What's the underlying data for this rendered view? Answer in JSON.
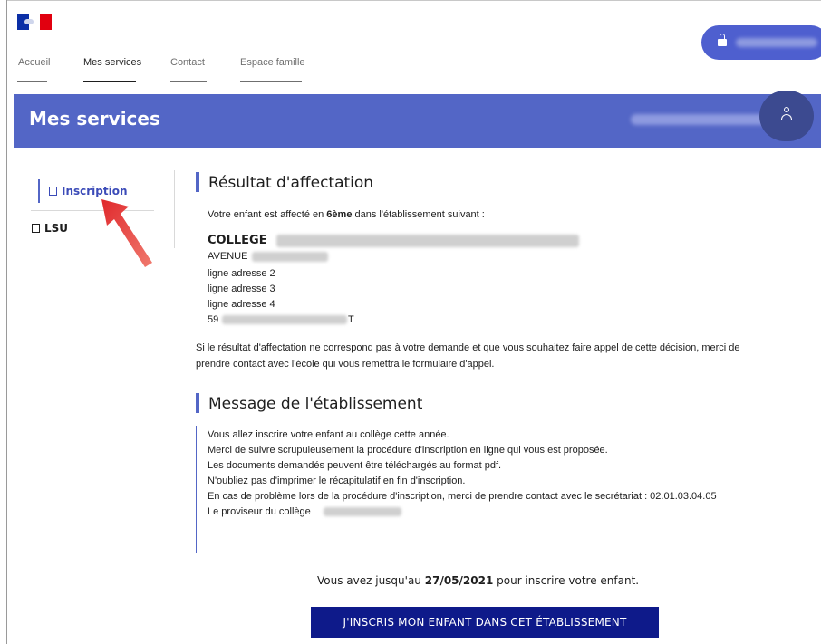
{
  "header": {
    "nav": [
      {
        "label": "Accueil"
      },
      {
        "label": "Mes services"
      },
      {
        "label": "Contact"
      },
      {
        "label": "Espace famille"
      }
    ]
  },
  "banner": {
    "title": "Mes services"
  },
  "sidebar": {
    "items": [
      {
        "label": "Inscription",
        "icon": "document-icon",
        "active": true
      },
      {
        "label": "LSU",
        "icon": "book-icon",
        "active": false
      }
    ]
  },
  "affectation": {
    "title": "Résultat d'affectation",
    "intro_before": "Votre enfant est affecté en",
    "intro_level": "6ème",
    "intro_after": "dans l'établissement suivant :",
    "school_name": "COLLEGE",
    "address": [
      "AVENUE",
      "ligne adresse 2",
      "ligne adresse 3",
      "ligne adresse 4",
      "59"
    ],
    "address_city_tail": "T",
    "appeal_line1": "Si le résultat d'affectation ne correspond pas à votre demande et que vous souhaitez faire appel de cette décision, merci de",
    "appeal_line2": "prendre contact avec l'école qui vous remettra le formulaire d'appel."
  },
  "message": {
    "title": "Message de l'établissement",
    "lines": [
      "Vous allez inscrire votre enfant au collège cette année.",
      "Merci de suivre scrupuleusement la procédure d'inscription en ligne qui vous est proposée.",
      "Les documents demandés peuvent être téléchargés au format pdf.",
      "N'oubliez pas d'imprimer le récapitulatif en fin d'inscription.",
      "En cas de problème lors de la procédure d'inscription, merci de prendre contact avec le secrétariat : 02.01.03.04.05",
      "Le proviseur du collège"
    ]
  },
  "deadline": {
    "before": "Vous avez jusqu'au",
    "date": "27/05/2021",
    "after": "pour inscrire votre enfant."
  },
  "cta": {
    "label": "J'INSCRIS MON ENFANT DANS CET ÉTABLISSEMENT"
  },
  "colors": {
    "primary": "#5366c6",
    "cta": "#0e1a8a",
    "arrow": "#e0282c"
  }
}
